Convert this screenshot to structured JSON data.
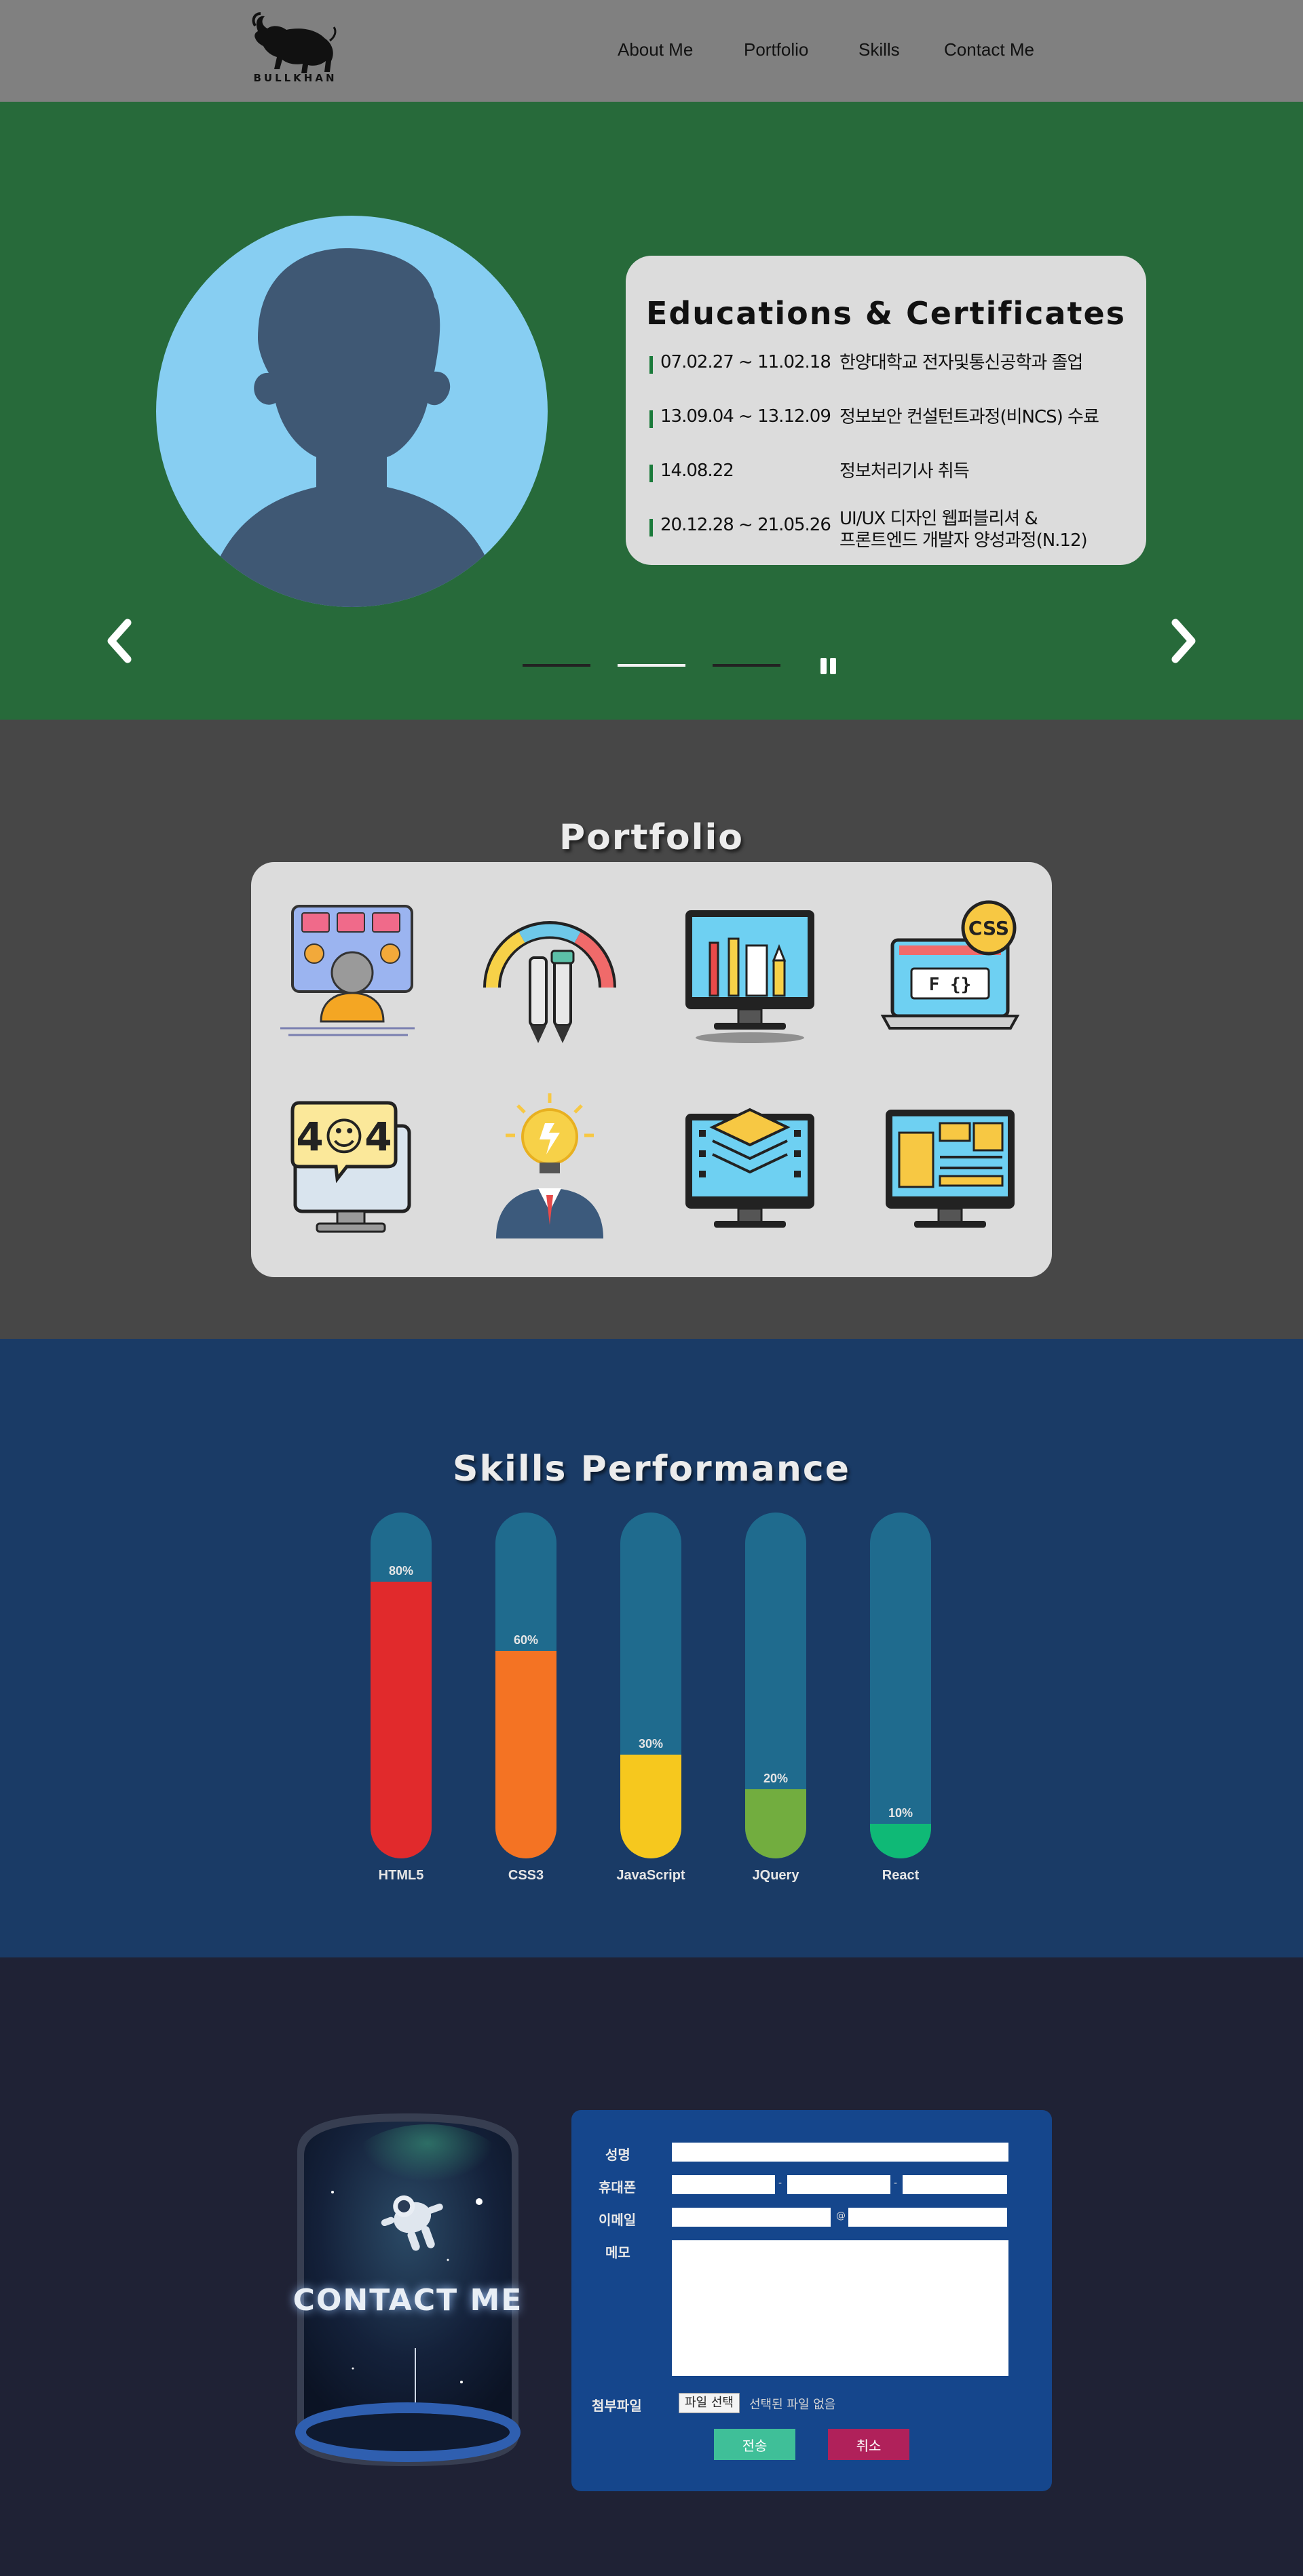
{
  "header": {
    "logo_text": "BULLKHAN",
    "nav": [
      "About Me",
      "Portfolio",
      "Skills",
      "Contact Me"
    ]
  },
  "hero": {
    "card_title": "Educations & Certificates",
    "rows": [
      {
        "date": "07.02.27 ~ 11.02.18",
        "desc": "한양대학교 전자및통신공학과 졸업"
      },
      {
        "date": "13.09.04 ~ 13.12.09",
        "desc": "정보보안 컨설턴트과정(비NCS) 수료"
      },
      {
        "date": "14.08.22",
        "desc": "정보처리기사 취득"
      },
      {
        "date": "20.12.28 ~ 21.05.26",
        "desc": "UI/UX 디자인 웹퍼블리셔 &\n프론트엔드 개발자 양성과정(N.12)"
      }
    ],
    "slides": 3,
    "active_slide": 2,
    "colors": {
      "bg": "#276a3a",
      "card": "#dcdcdc",
      "avatar_bg": "#87cef2",
      "avatar_fg": "#3f5874"
    }
  },
  "portfolio": {
    "title": "Portfolio",
    "icons": [
      "developer-monitor-icon",
      "design-tools-icon",
      "graphic-design-monitor-icon",
      "css-laptop-icon",
      "error-404-monitor-icon",
      "idea-businessman-icon",
      "layers-monitor-icon",
      "web-layout-monitor-icon"
    ]
  },
  "skills": {
    "title": "Skills Performance",
    "items": [
      {
        "name": "HTML5",
        "value": 80,
        "label": "80%",
        "color": "#e12a2c"
      },
      {
        "name": "CSS3",
        "value": 60,
        "label": "60%",
        "color": "#f47323"
      },
      {
        "name": "JavaScript",
        "value": 30,
        "label": "30%",
        "color": "#f6c81e"
      },
      {
        "name": "JQuery",
        "value": 20,
        "label": "20%",
        "color": "#72ad3f"
      },
      {
        "name": "React",
        "value": 10,
        "label": "10%",
        "color": "#0fb976"
      }
    ]
  },
  "contact": {
    "image_label": "CONTACT ME",
    "form": {
      "name_label": "성명",
      "phone_label": "휴대폰",
      "email_label": "이메일",
      "email_at": "@",
      "memo_label": "메모",
      "file_label": "첨부파일",
      "file_button": "파일 선택",
      "file_none": "선택된 파일 없음",
      "submit_label": "전송",
      "cancel_label": "취소"
    }
  }
}
